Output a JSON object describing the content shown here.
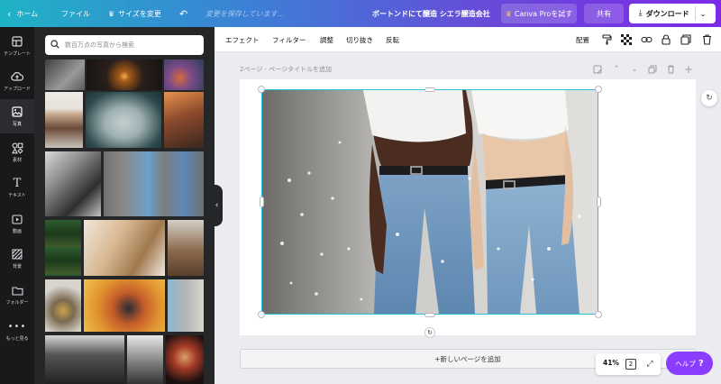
{
  "topbar": {
    "home": "ホーム",
    "file": "ファイル",
    "resize": "サイズを変更",
    "save_status": "変更を保存しています...",
    "doc_title": "ボートンドにて醸造 シエラ醸造会社",
    "pro_button": "Canva Proを試す",
    "share": "共有",
    "download": "ダウンロード"
  },
  "rail": {
    "items": [
      {
        "label": "テンプレート",
        "icon": "template-icon"
      },
      {
        "label": "アップロード",
        "icon": "upload-icon"
      },
      {
        "label": "写真",
        "icon": "photo-icon"
      },
      {
        "label": "素材",
        "icon": "elements-icon"
      },
      {
        "label": "テキスト",
        "icon": "text-icon"
      },
      {
        "label": "動画",
        "icon": "video-icon"
      },
      {
        "label": "背景",
        "icon": "background-icon"
      },
      {
        "label": "フォルダー",
        "icon": "folder-icon"
      },
      {
        "label": "もっと見る",
        "icon": "more-icon"
      }
    ],
    "active_index": 2
  },
  "panel": {
    "search_placeholder": "数百万点の写真から検索"
  },
  "context_toolbar": {
    "effects": "エフェクト",
    "filters": "フィルター",
    "adjust": "調整",
    "crop": "切り抜き",
    "flip": "反転",
    "position": "配置"
  },
  "workspace": {
    "page_title": "2ページ - ページタイトルを追加",
    "add_page": "+新しいページを追加",
    "zoom": "41%",
    "page_count": "2",
    "help": "ヘルプ",
    "help_mark": "?"
  },
  "colors": {
    "accent": "#8b3dff",
    "selection": "#23c4d9",
    "rail_bg": "#18191b",
    "panel_bg": "#252627"
  }
}
